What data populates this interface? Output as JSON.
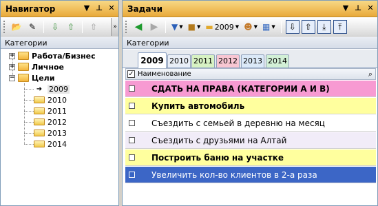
{
  "navigator": {
    "title": "Навигатор",
    "header_buttons": [
      "▼",
      "ᵽ",
      "✕"
    ],
    "category_label": "Категории",
    "tree": [
      {
        "label": "Работа/Бизнес",
        "bold": true,
        "expander": "+"
      },
      {
        "label": "Личное",
        "bold": true,
        "expander": "+"
      },
      {
        "label": "Цели",
        "bold": true,
        "expander": "−"
      },
      {
        "label": "2009",
        "selected": true
      },
      {
        "label": "2010"
      },
      {
        "label": "2011"
      },
      {
        "label": "2012"
      },
      {
        "label": "2013"
      },
      {
        "label": "2014"
      }
    ]
  },
  "tasks": {
    "title": "Задачи",
    "header_buttons": [
      "▼",
      "ᵽ",
      "✕"
    ],
    "toolbar": {
      "year_label": "2009"
    },
    "category_label": "Категории",
    "tabs": [
      {
        "label": "2009",
        "color": "#ffffff",
        "active": true
      },
      {
        "label": "2010",
        "color": "#e9eef7"
      },
      {
        "label": "2011",
        "color": "#d7f2c3"
      },
      {
        "label": "2012",
        "color": "#f8c6d2"
      },
      {
        "label": "2013",
        "color": "#dbe9f8"
      },
      {
        "label": "2014",
        "color": "#d2f0d6"
      }
    ],
    "column_header": "Наименование",
    "rows": [
      {
        "text": "СДАТЬ НА ПРАВА (КАТЕГОРИИ А И В)",
        "bg": "#f79ad2",
        "bold": true
      },
      {
        "text": "Купить автомобиль",
        "bg": "#ffff9e",
        "bold": true
      },
      {
        "text": "Съездить с семьей в деревню на месяц",
        "bg": "#ffffff",
        "bold": false
      },
      {
        "text": "Съездить с друзьями на Алтай",
        "bg": "#f1ecf8",
        "bold": false
      },
      {
        "text": "Построить баню на участке",
        "bg": "#ffff9e",
        "bold": true
      },
      {
        "text": "Увеличить кол-во клиентов в 2-а раза",
        "bg": "#3c66c6",
        "bold": false,
        "selected": true
      }
    ]
  },
  "colors": {
    "header_gradient": "#f1c15f",
    "selection": "#3c66c6"
  }
}
